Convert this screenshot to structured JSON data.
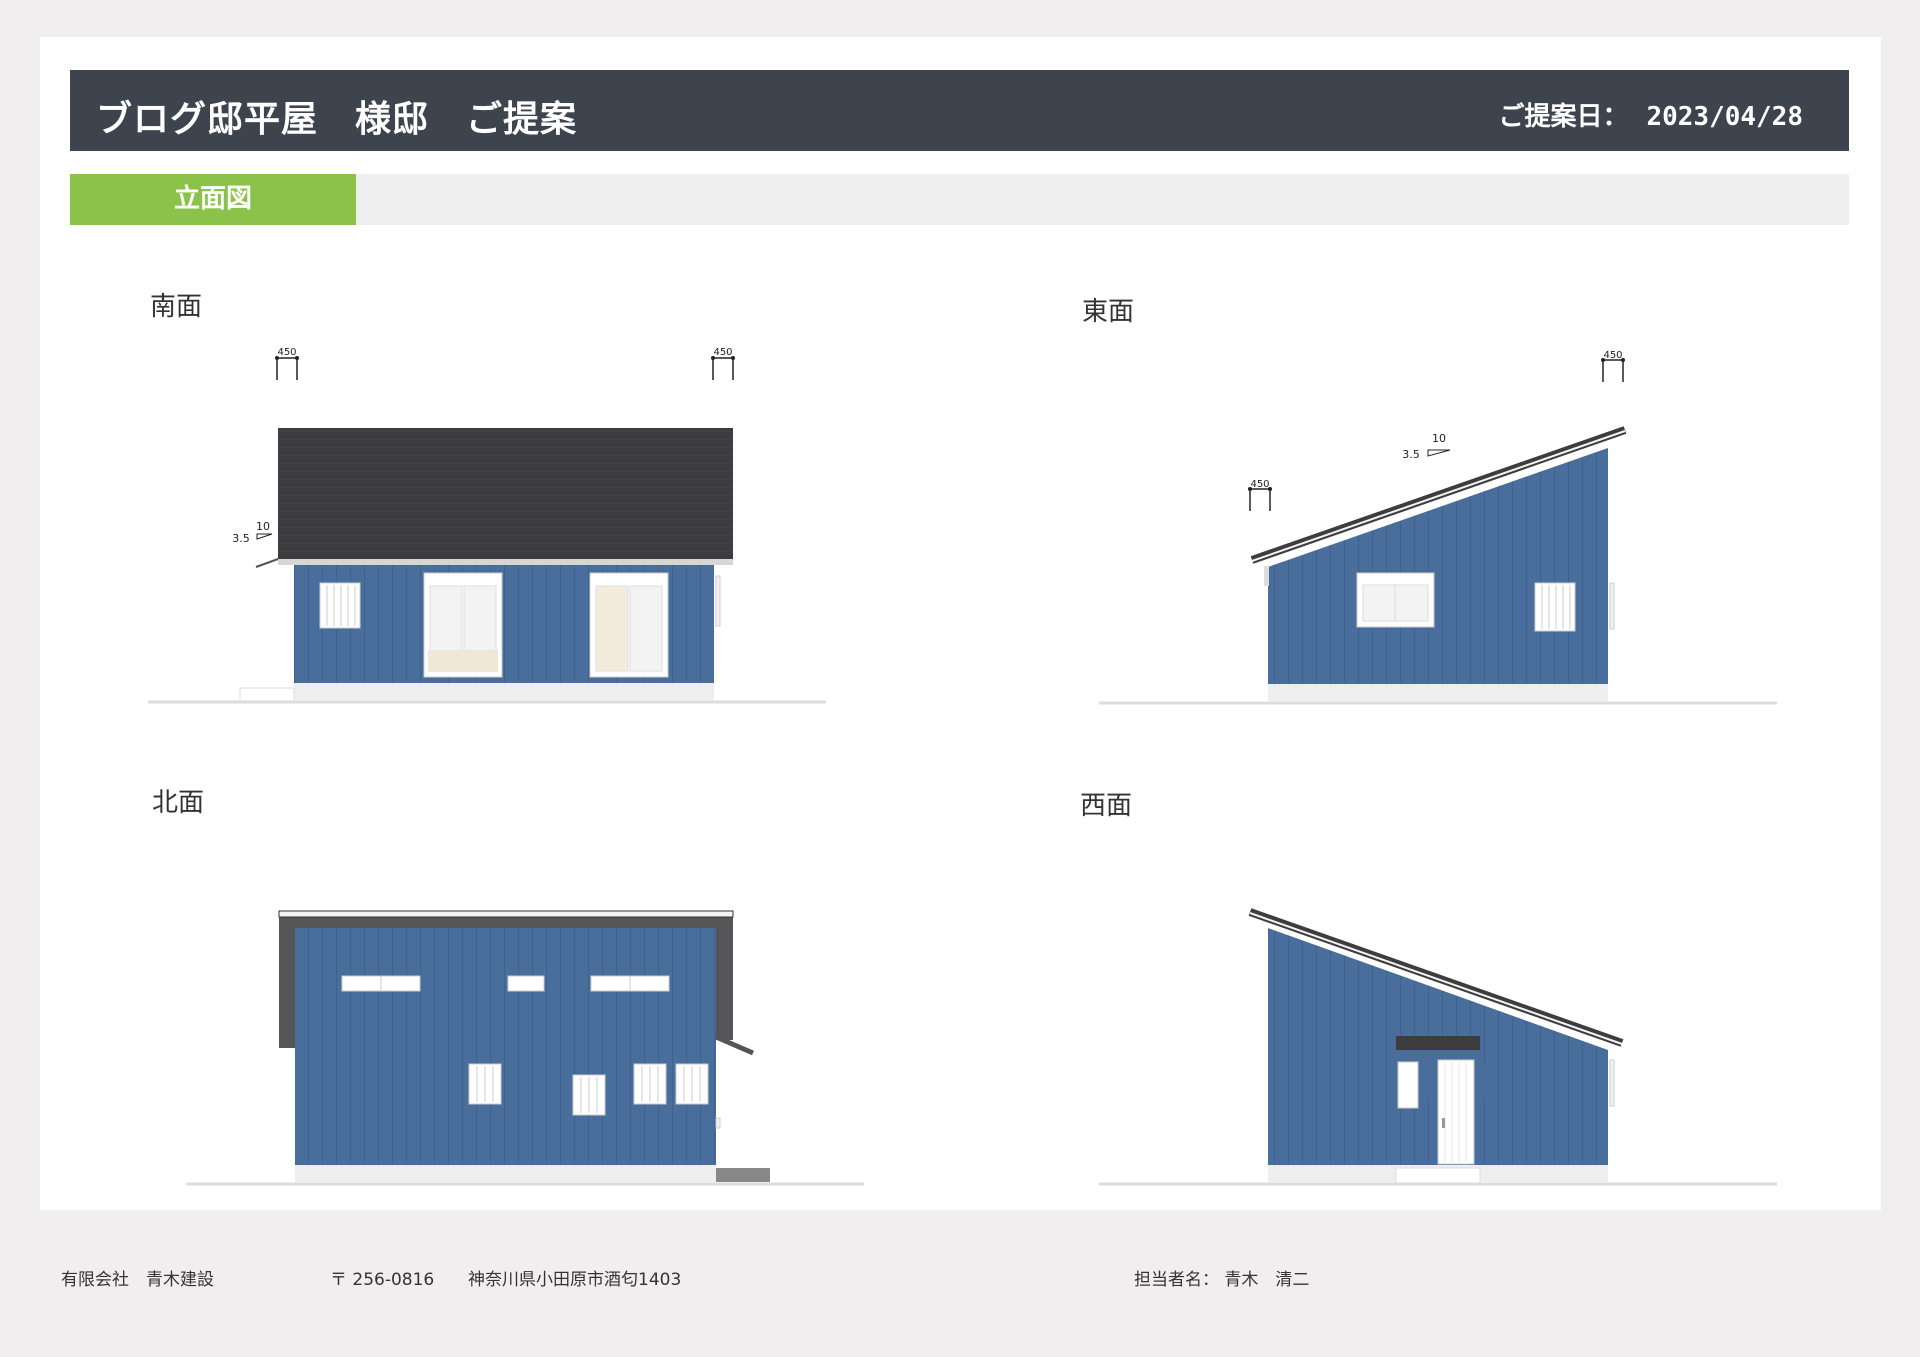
{
  "header": {
    "title": "ブログ邸平屋　様邸　ご提案",
    "date_label": "ご提案日：",
    "date_value": "2023/04/28"
  },
  "section": {
    "label": "立面図"
  },
  "views": {
    "south": {
      "label": "南面",
      "dim_left": "450",
      "dim_right": "450",
      "pitch_run": "10",
      "pitch_rise": "3.5"
    },
    "east": {
      "label": "東面",
      "dim_top": "450",
      "dim_left": "450",
      "pitch_run": "10",
      "pitch_rise": "3.5"
    },
    "north": {
      "label": "北面"
    },
    "west": {
      "label": "西面"
    }
  },
  "colors": {
    "siding": "#4a6e9c",
    "roof": "#3d3d3f",
    "header_bg": "#3d444e",
    "accent_green": "#8bc34a"
  },
  "footer": {
    "company": "有限会社　青木建設",
    "postal": "〒 256-0816",
    "address": "神奈川県小田原市酒匂1403",
    "person_label": "担当者名：",
    "person_name": "青木　清二"
  }
}
